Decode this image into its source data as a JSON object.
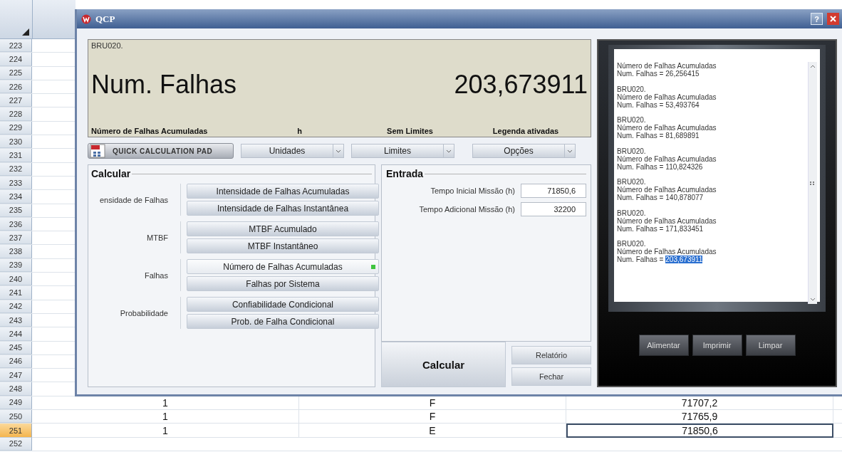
{
  "sheet": {
    "rows": [
      {
        "number": "223",
        "selected": false
      },
      {
        "number": "224",
        "selected": false
      },
      {
        "number": "225",
        "selected": false
      },
      {
        "number": "226",
        "selected": false
      },
      {
        "number": "227",
        "selected": false
      },
      {
        "number": "228",
        "selected": false
      },
      {
        "number": "229",
        "selected": false
      },
      {
        "number": "230",
        "selected": false
      },
      {
        "number": "231",
        "selected": false
      },
      {
        "number": "232",
        "selected": false
      },
      {
        "number": "233",
        "selected": false
      },
      {
        "number": "234",
        "selected": false
      },
      {
        "number": "235",
        "selected": false
      },
      {
        "number": "236",
        "selected": false
      },
      {
        "number": "237",
        "selected": false
      },
      {
        "number": "238",
        "selected": false
      },
      {
        "number": "239",
        "selected": false
      },
      {
        "number": "240",
        "selected": false
      },
      {
        "number": "241",
        "selected": false
      },
      {
        "number": "242",
        "selected": false
      },
      {
        "number": "243",
        "selected": false
      },
      {
        "number": "244",
        "selected": false
      },
      {
        "number": "245",
        "selected": false
      },
      {
        "number": "246",
        "selected": false
      },
      {
        "number": "247",
        "selected": false
      },
      {
        "number": "248",
        "selected": false
      },
      {
        "number": "249",
        "selected": false,
        "cells": [
          {
            "text": "1",
            "selected": false
          },
          {
            "text": "F",
            "selected": false
          },
          {
            "text": "71707,2",
            "selected": false
          }
        ]
      },
      {
        "number": "250",
        "selected": false,
        "cells": [
          {
            "text": "1",
            "selected": false
          },
          {
            "text": "F",
            "selected": false
          },
          {
            "text": "71765,9",
            "selected": false
          }
        ]
      },
      {
        "number": "251",
        "selected": true,
        "cells": [
          {
            "text": "1",
            "selected": false
          },
          {
            "text": "E",
            "selected": false
          },
          {
            "text": "71850,6",
            "selected": true
          }
        ]
      },
      {
        "number": "252",
        "selected": false
      }
    ]
  },
  "window": {
    "title": "QCP",
    "help": "?"
  },
  "display": {
    "source": "BRU020.",
    "quantity": "Num. Falhas",
    "value": "203,673911",
    "captions": [
      "Número de Falhas Acumuladas",
      "h",
      "Sem Limites",
      "Legenda ativadas"
    ],
    "pad_button": "QUICK CALCULATION PAD",
    "dropdowns": [
      "Unidades",
      "Limites",
      "Opções"
    ]
  },
  "calculate": {
    "title": "Calcular",
    "groups": [
      {
        "label": "ensidade de Falhas",
        "buttons": [
          {
            "label": "Intensidade de Falhas Acumuladas",
            "selected": false
          },
          {
            "label": "Intensidade de Falhas Instantânea",
            "selected": false
          }
        ]
      },
      {
        "label": "MTBF",
        "buttons": [
          {
            "label": "MTBF Acumulado",
            "selected": false
          },
          {
            "label": "MTBF Instantâneo",
            "selected": false
          }
        ]
      },
      {
        "label": "Falhas",
        "buttons": [
          {
            "label": "Número de Falhas Acumuladas",
            "selected": true
          },
          {
            "label": "Falhas por Sistema",
            "selected": false
          }
        ]
      },
      {
        "label": "Probabilidade",
        "buttons": [
          {
            "label": "Confiabilidade Condicional",
            "selected": false
          },
          {
            "label": "Prob. de Falha Condicional",
            "selected": false
          }
        ]
      }
    ]
  },
  "input": {
    "title": "Entrada",
    "fields": [
      {
        "label": "Tempo Inicial Missão (h)",
        "value": "71850,6"
      },
      {
        "label": "Tempo Adicional Missão (h)",
        "value": "32200"
      }
    ]
  },
  "actions": {
    "calculate": "Calcular",
    "report": "Relatório",
    "close": "Fechar"
  },
  "printer": {
    "entries": [
      {
        "lines": [
          "Número de Falhas Acumuladas"
        ],
        "label": "Num. Falhas =",
        "value": "26,256415",
        "highlighted": false
      },
      {
        "lines": [
          "BRU020.",
          "Número de Falhas Acumuladas"
        ],
        "label": "Num. Falhas =",
        "value": "53,493764",
        "highlighted": false
      },
      {
        "lines": [
          "BRU020.",
          "Número de Falhas Acumuladas"
        ],
        "label": "Num. Falhas =",
        "value": "81,689891",
        "highlighted": false
      },
      {
        "lines": [
          "BRU020.",
          "Número de Falhas Acumuladas"
        ],
        "label": "Num. Falhas =",
        "value": "110,824326",
        "highlighted": false
      },
      {
        "lines": [
          "BRU020.",
          "Número de Falhas Acumuladas"
        ],
        "label": "Num. Falhas =",
        "value": "140,878077",
        "highlighted": false
      },
      {
        "lines": [
          "BRU020.",
          "Número de Falhas Acumuladas"
        ],
        "label": "Num. Falhas =",
        "value": "171,833451",
        "highlighted": false
      },
      {
        "lines": [
          "BRU020.",
          "Número de Falhas Acumuladas"
        ],
        "label": "Num. Falhas =",
        "value": "203,673911",
        "highlighted": true
      }
    ],
    "buttons": [
      "Alimentar",
      "Imprimir",
      "Limpar"
    ]
  }
}
